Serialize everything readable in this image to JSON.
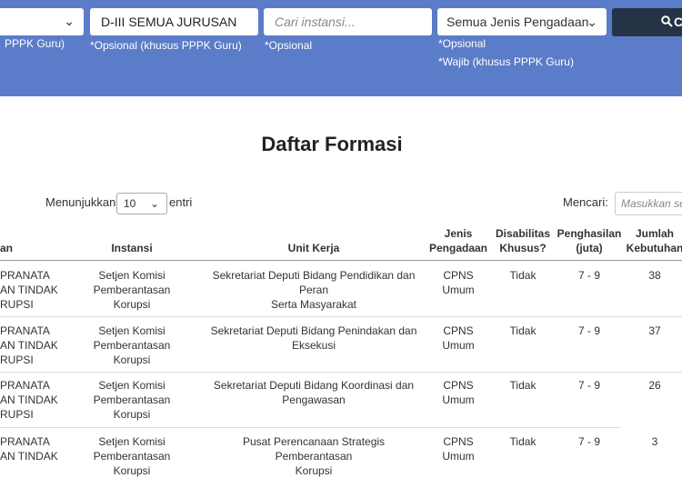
{
  "filters": {
    "formation_hint": "PPPK Guru)",
    "education_value": "D-III SEMUA JURUSAN",
    "education_hint": "*Opsional (khusus PPPK Guru)",
    "agency_placeholder": "Cari instansi...",
    "agency_hint": "*Opsional",
    "procurement_value": "Semua Jenis Pengadaan",
    "procurement_hint1": "*Opsional",
    "procurement_hint2": "*Wajib (khusus PPPK Guru)",
    "search_label": "C"
  },
  "title": "Daftar Formasi",
  "length_control": {
    "before": "Menunjukkan",
    "value": "10",
    "after": "entri"
  },
  "search_control": {
    "label": "Mencari:",
    "placeholder": "Masukkan se"
  },
  "table": {
    "headers": {
      "jabatan": "an",
      "instansi": "Instansi",
      "unit": "Unit Kerja",
      "jenis1": "Jenis",
      "jenis2": "Pengadaan",
      "dis1": "Disabilitas",
      "dis2": "Khusus?",
      "gaji1": "Penghasilan",
      "gaji2": "(juta)",
      "keb1": "Jumlah",
      "keb2": "Kebutuhan"
    },
    "rows": [
      {
        "jab1": "PRANATA",
        "jab2": "AN TINDAK",
        "jab3": "RUPSI",
        "inst1": "Setjen Komisi Pemberantasan",
        "inst2": "Korupsi",
        "unit1": "Sekretariat Deputi Bidang Pendidikan dan Peran",
        "unit2": "Serta Masyarakat",
        "jenis1": "CPNS",
        "jenis2": "Umum",
        "dis": "Tidak",
        "gaji": "7 - 9",
        "keb": "38"
      },
      {
        "jab1": "PRANATA",
        "jab2": "AN TINDAK",
        "jab3": "RUPSI",
        "inst1": "Setjen Komisi Pemberantasan",
        "inst2": "Korupsi",
        "unit1": "Sekretariat Deputi Bidang Penindakan dan",
        "unit2": "Eksekusi",
        "jenis1": "CPNS",
        "jenis2": "Umum",
        "dis": "Tidak",
        "gaji": "7 - 9",
        "keb": "37"
      },
      {
        "jab1": "PRANATA",
        "jab2": "AN TINDAK",
        "jab3": "RUPSI",
        "inst1": "Setjen Komisi Pemberantasan",
        "inst2": "Korupsi",
        "unit1": "Sekretariat Deputi Bidang Koordinasi dan",
        "unit2": "Pengawasan",
        "jenis1": "CPNS",
        "jenis2": "Umum",
        "dis": "Tidak",
        "gaji": "7 - 9",
        "keb": "26"
      },
      {
        "jab1": "PRANATA",
        "jab2": "AN TINDAK",
        "jab3": "",
        "inst1": "Setjen Komisi Pemberantasan",
        "inst2": "Korupsi",
        "unit1": "Pusat Perencanaan Strategis Pemberantasan",
        "unit2": "Korupsi",
        "jenis1": "CPNS",
        "jenis2": "Umum",
        "dis": "Tidak",
        "gaji": "7 - 9",
        "keb": "3"
      }
    ]
  }
}
